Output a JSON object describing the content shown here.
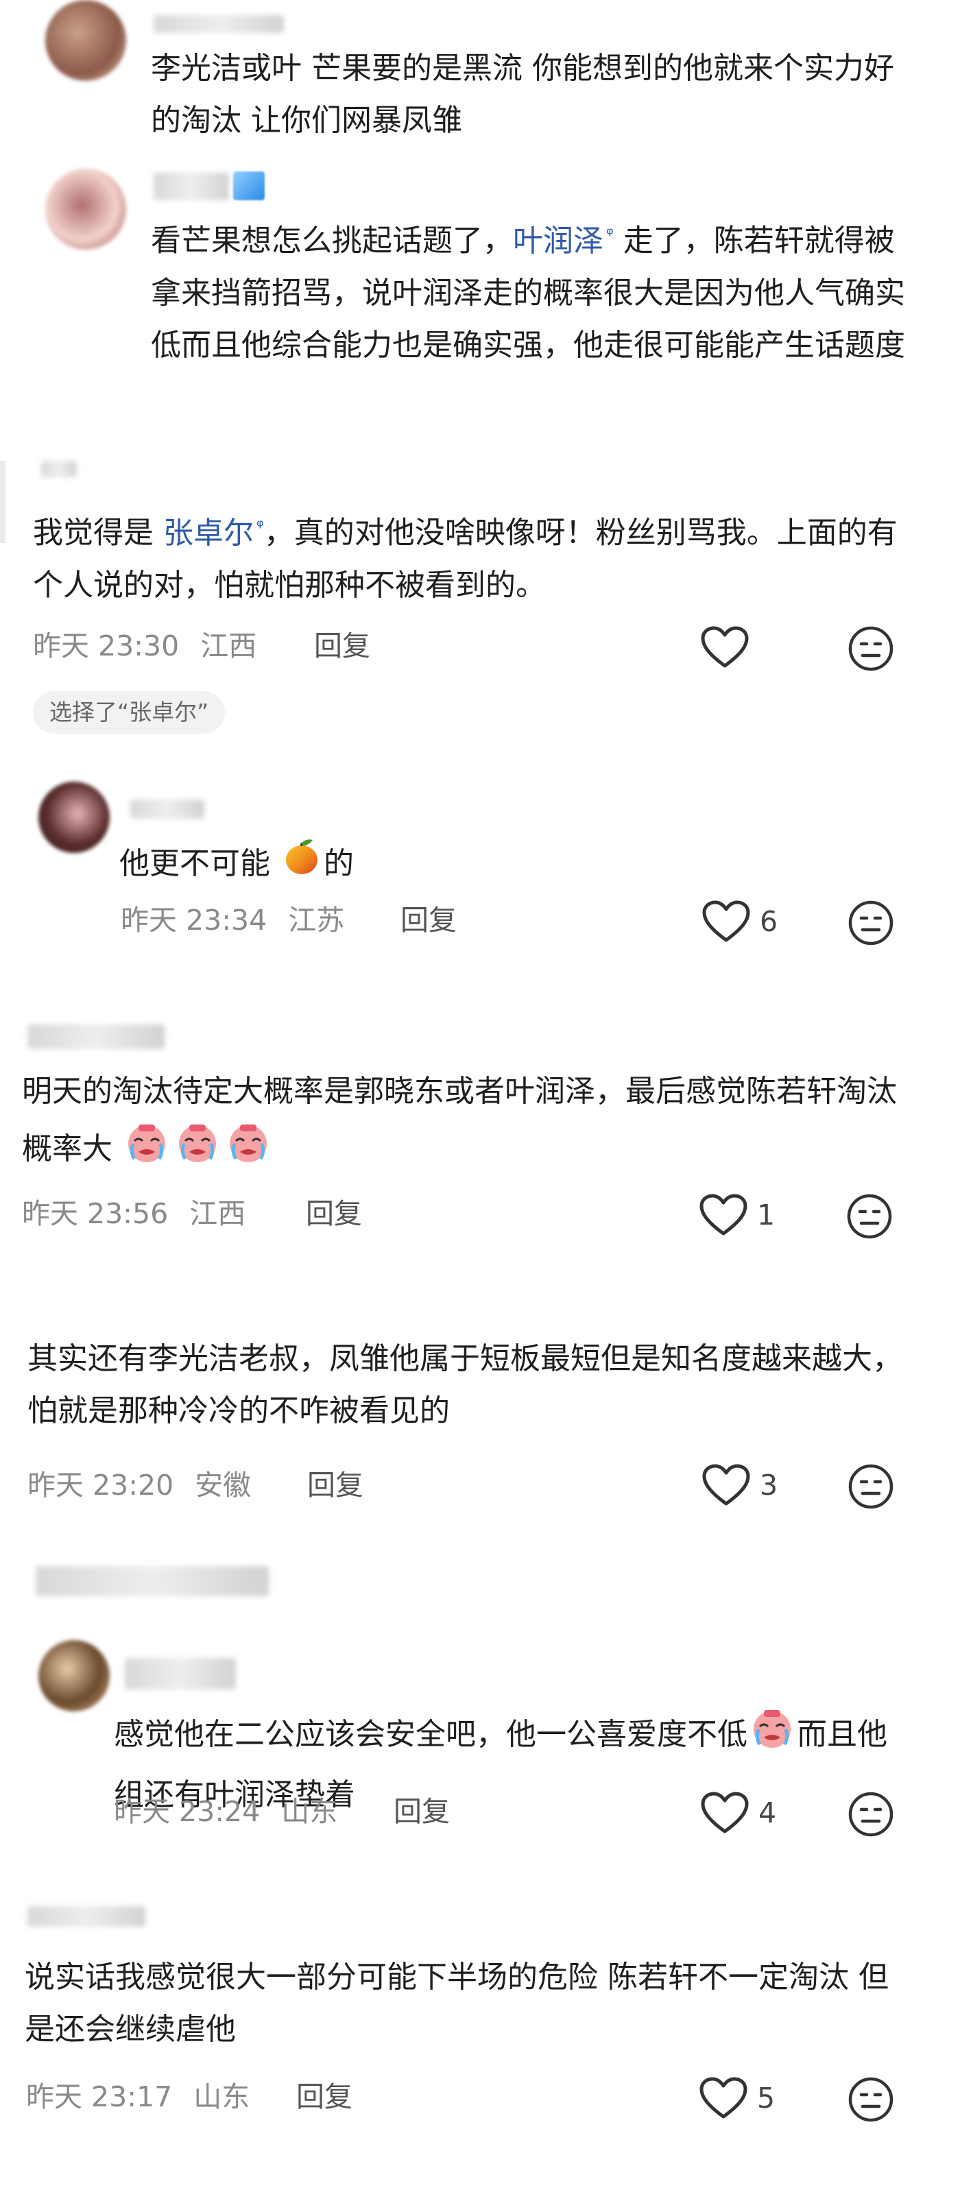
{
  "comments": [
    {
      "id": "c1",
      "text": "李光洁或叶 芒果要的是黑流 你能想到的他就来个实力好的淘汰 让你们网暴凤雏"
    },
    {
      "id": "c2",
      "text_before": "看芒果想怎么挑起话题了，",
      "mention": "叶润泽",
      "text_after": "走了，陈若轩就得被拿来挡箭招骂，说叶润泽走的概率很大是因为他人气确实低而且他综合能力也是确实强，他走很可能能产生话题度"
    },
    {
      "id": "c3",
      "text_before": "我觉得是",
      "mention": "张卓尔",
      "text_after": "，真的对他没啥映像呀！粉丝别骂我。上面的有个人说的对，怕就怕那种不被看到的。",
      "time": "昨天 23:30",
      "location": "江西",
      "reply": "回复",
      "choice_tag": "选择了“张卓尔”"
    },
    {
      "id": "c4",
      "text_before": "他更不可能",
      "emoji": "mango",
      "text_after": "的",
      "time": "昨天 23:34",
      "location": "江苏",
      "reply": "回复",
      "likes": "6"
    },
    {
      "id": "c5",
      "text": "明天的淘汰待定大概率是郭晓东或者叶润泽，最后感觉陈若轩淘汰概率大",
      "emoji": "crying-face",
      "time": "昨天 23:56",
      "location": "江西",
      "reply": "回复",
      "likes": "1"
    },
    {
      "id": "c6",
      "text": "其实还有李光洁老叔，凤雏他属于短板最短但是知名度越来越大，怕就是那种冷冷的不咋被看见的",
      "time": "昨天 23:20",
      "location": "安徽",
      "reply": "回复",
      "likes": "3"
    },
    {
      "id": "c7",
      "text_before": "感觉他在二公应该会安全吧，他一公喜爱度不低",
      "emoji": "crying-face",
      "text_after": "而且他组还有叶润泽垫着",
      "time": "昨天 23:24",
      "location": "山东",
      "reply": "回复",
      "likes": "4"
    },
    {
      "id": "c8",
      "text": "说实话我感觉很大一部分可能下半场的危险 陈若轩不一定淘汰 但是还会继续虐他",
      "time": "昨天 23:17",
      "location": "山东",
      "reply": "回复",
      "likes": "5"
    }
  ],
  "icons": {
    "like": "heart-outline-icon",
    "react": "neutral-face-icon"
  },
  "colors": {
    "mention": "#2e5aa8",
    "meta": "#8a8a8a",
    "text": "#1f1f1f"
  }
}
